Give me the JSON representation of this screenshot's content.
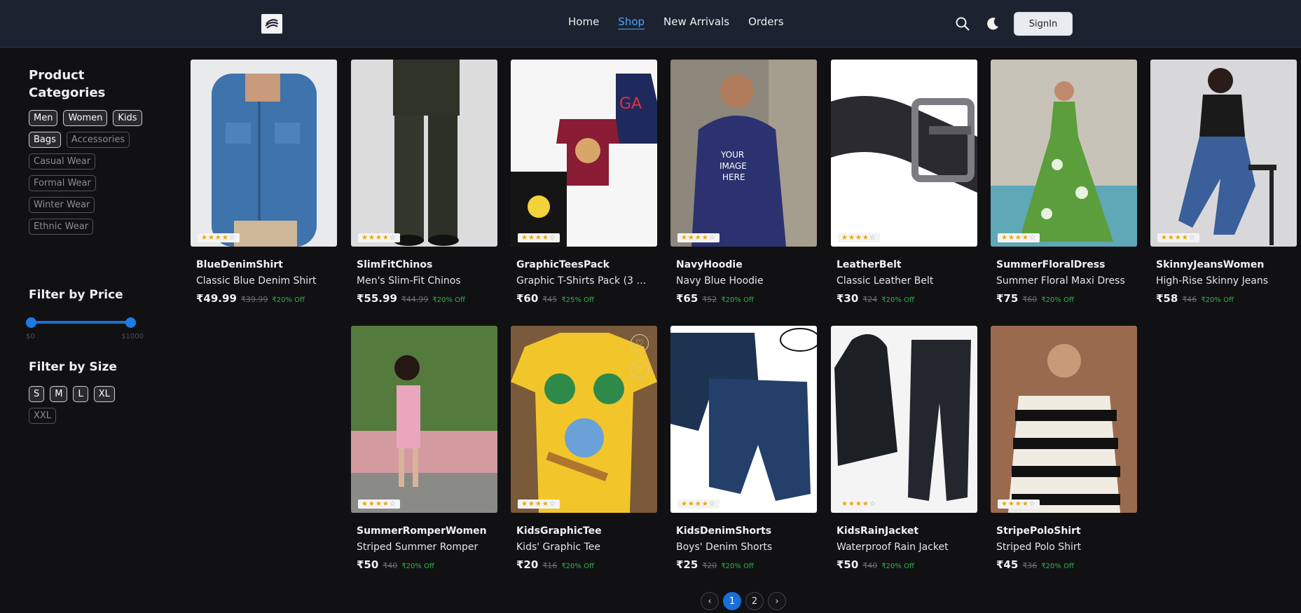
{
  "header": {
    "nav": [
      "Home",
      "Shop",
      "New Arrivals",
      "Orders"
    ],
    "active_nav": "Shop",
    "signin_label": "SignIn",
    "icons": [
      "search-icon",
      "moon-icon"
    ]
  },
  "sidebar": {
    "categories_title": "Product Categories",
    "categories": [
      "Men",
      "Women",
      "Kids",
      "Bags",
      "Accessories",
      "Casual Wear",
      "Formal Wear",
      "Winter Wear",
      "Ethnic Wear"
    ],
    "price_title": "Filter by Price",
    "price_min_label": "$0",
    "price_max_label": "$1000",
    "size_title": "Filter by Size",
    "sizes": [
      "S",
      "M",
      "L",
      "XL",
      "XXL"
    ]
  },
  "products": [
    {
      "name": "BlueDenimShirt",
      "title": "Classic Blue Denim Shirt",
      "price": "₹49.99",
      "old": "₹39.99",
      "off": "₹20% Off",
      "rating": 4
    },
    {
      "name": "SlimFitChinos",
      "title": "Men's Slim-Fit Chinos",
      "price": "₹55.99",
      "old": "₹44.99",
      "off": "₹20% Off",
      "rating": 4
    },
    {
      "name": "GraphicTeesPack",
      "title": "Graphic T-Shirts Pack (3 pc...",
      "price": "₹60",
      "old": "₹45",
      "off": "₹25% Off",
      "rating": 4
    },
    {
      "name": "NavyHoodie",
      "title": "Navy Blue Hoodie",
      "price": "₹65",
      "old": "₹52",
      "off": "₹20% Off",
      "rating": 4
    },
    {
      "name": "LeatherBelt",
      "title": "Classic Leather Belt",
      "price": "₹30",
      "old": "₹24",
      "off": "₹20% Off",
      "rating": 4
    },
    {
      "name": "SummerFloralDress",
      "title": "Summer Floral Maxi Dress",
      "price": "₹75",
      "old": "₹60",
      "off": "₹20% Off",
      "rating": 4
    },
    {
      "name": "SkinnyJeansWomen",
      "title": "High-Rise Skinny Jeans",
      "price": "₹58",
      "old": "₹46",
      "off": "₹20% Off",
      "rating": 4
    },
    {
      "name": "SummerRomperWomen",
      "title": "Striped Summer Romper",
      "price": "₹50",
      "old": "₹40",
      "off": "₹20% Off",
      "rating": 4
    },
    {
      "name": "KidsGraphicTee",
      "title": "Kids' Graphic Tee",
      "price": "₹20",
      "old": "₹16",
      "off": "₹20% Off",
      "rating": 4
    },
    {
      "name": "KidsDenimShorts",
      "title": "Boys' Denim Shorts",
      "price": "₹25",
      "old": "₹20",
      "off": "₹20% Off",
      "rating": 4
    },
    {
      "name": "KidsRainJacket",
      "title": "Waterproof Rain Jacket",
      "price": "₹50",
      "old": "₹40",
      "off": "₹20% Off",
      "rating": 4
    },
    {
      "name": "StripePoloShirt",
      "title": "Striped Polo Shirt",
      "price": "₹45",
      "old": "₹36",
      "off": "₹20% Off",
      "rating": 4
    }
  ],
  "pagination": {
    "pages": [
      "1",
      "2"
    ],
    "current": "1"
  }
}
